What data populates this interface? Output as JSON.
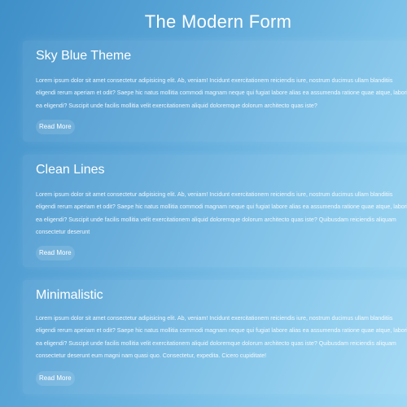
{
  "page": {
    "title": "The Modern Form"
  },
  "cards": [
    {
      "title": "Sky Blue Theme",
      "lines": [
        "Lorem ipsum dolor sit amet consectetur adipisicing elit. Ab, veniam! Incidunt exercitationem reiciendis iure, nostrum ducimus ullam blanditiis",
        "eligendi rerum aperiam et odit? Saepe hic natus mollitia commodi magnam neque qui fugiat labore alias ea assumenda ratione quae atque, laboriosam",
        "ea eligendi? Suscipit unde facilis mollitia velit exercitationem aliquid doloremque dolorum architecto quas iste?"
      ],
      "button": "Read More"
    },
    {
      "title": "Clean Lines",
      "lines": [
        "Lorem ipsum dolor sit amet consectetur adipisicing elit. Ab, veniam! Incidunt exercitationem reiciendis iure, nostrum ducimus ullam blanditiis",
        "eligendi rerum aperiam et odit? Saepe hic natus mollitia commodi magnam neque qui fugiat labore alias ea assumenda ratione quae atque, laboriosam",
        "ea eligendi? Suscipit unde facilis mollitia velit exercitationem aliquid doloremque dolorum architecto quas iste? Quibusdam reiciendis aliquam",
        "consectetur deserunt"
      ],
      "button": "Read More"
    },
    {
      "title": "Minimalistic",
      "lines": [
        "Lorem ipsum dolor sit amet consectetur adipisicing elit. Ab, veniam! Incidunt exercitationem reiciendis iure, nostrum ducimus ullam blanditiis",
        "eligendi rerum aperiam et odit? Saepe hic natus mollitia commodi magnam neque qui fugiat labore alias ea assumenda ratione quae atque, laboriosam",
        "ea eligendi? Suscipit unde facilis mollitia velit exercitationem aliquid doloremque dolorum architecto quas iste? Quibusdam reiciendis aliquam",
        "consectetur deserunt eum magni nam quasi quo. Consectetur, expedita. Cicero cupiditate!"
      ],
      "button": "Read More"
    }
  ],
  "colors": {
    "background_start": "#3f8fc8",
    "background_end": "#9fd8f4",
    "text": "#ffffff"
  }
}
